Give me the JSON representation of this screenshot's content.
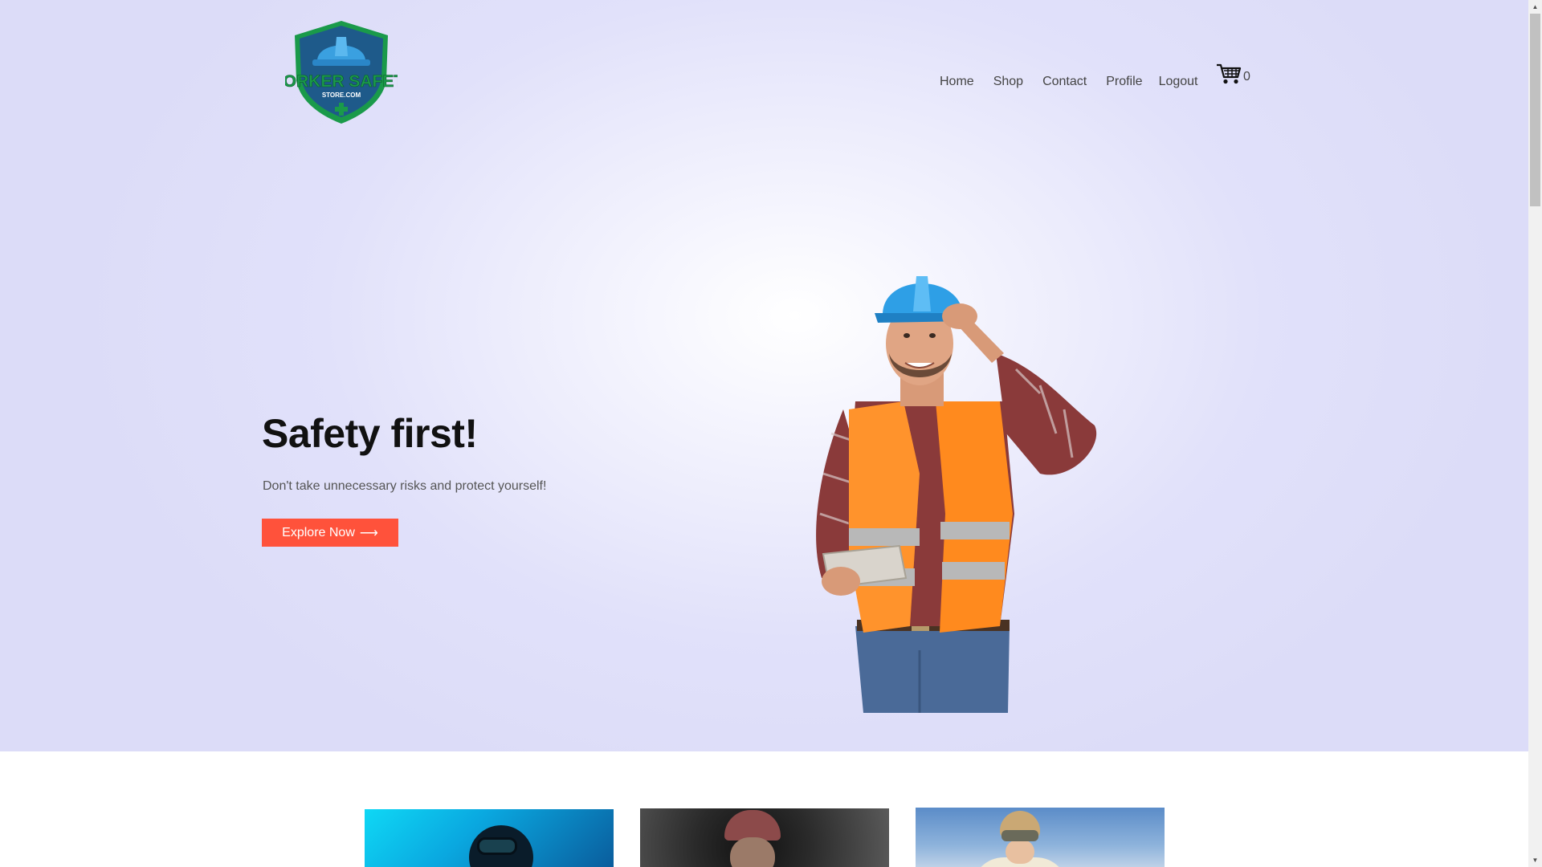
{
  "logo": {
    "line1": "WORKER SAFETY",
    "line2": "STORE.COM",
    "icon": "hardhat-shield-logo",
    "colors": {
      "shield_green": "#1a9a4a",
      "shield_blue": "#1e5a8a",
      "helmet": "#3aa0e0"
    }
  },
  "nav": {
    "items": [
      {
        "label": "Home"
      },
      {
        "label": "Shop"
      },
      {
        "label": "Contact"
      },
      {
        "label": "Profile"
      },
      {
        "label": "Logout"
      }
    ]
  },
  "cart": {
    "icon": "shopping-cart-icon",
    "count": "0"
  },
  "hero": {
    "title": "Safety first!",
    "subtitle": "Don't take unnecessary risks and protect yourself!",
    "button_label": "Explore Now",
    "button_arrow": "⟶",
    "button_color": "#ff523b"
  },
  "categories": [
    {
      "icon": "diver-image"
    },
    {
      "icon": "tunnel-worker-image"
    },
    {
      "icon": "skier-image"
    }
  ],
  "scrollbar": {
    "up": "▲",
    "down": "▼"
  }
}
